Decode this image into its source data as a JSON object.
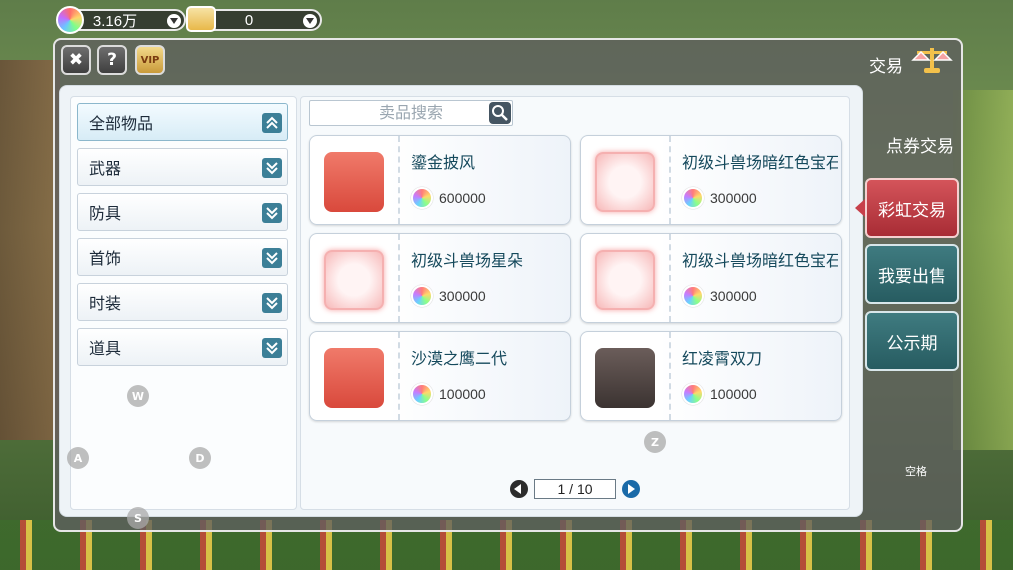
{
  "currency": {
    "rainbow_value": "3.16万",
    "coupon_value": "0"
  },
  "window": {
    "title": "交易",
    "close_label": "✖",
    "help_label": "?",
    "vip_label": "VIP"
  },
  "categories": [
    {
      "label": "全部物品",
      "active": true
    },
    {
      "label": "武器",
      "active": false
    },
    {
      "label": "防具",
      "active": false
    },
    {
      "label": "首饰",
      "active": false
    },
    {
      "label": "时装",
      "active": false
    },
    {
      "label": "道具",
      "active": false
    }
  ],
  "search": {
    "placeholder": "卖品搜索"
  },
  "items": [
    {
      "name": "鎏金披风",
      "price": "600000",
      "thumb": "cape-icon"
    },
    {
      "name": "初级斗兽场暗红色宝石",
      "price": "300000",
      "thumb": "earrings-icon"
    },
    {
      "name": "初级斗兽场星朵",
      "price": "300000",
      "thumb": "pendant-icon"
    },
    {
      "name": "初级斗兽场暗红色宝石",
      "price": "300000",
      "thumb": "ring-icon"
    },
    {
      "name": "沙漠之鹰二代",
      "price": "100000",
      "thumb": "pistol-icon"
    },
    {
      "name": "红凌霄双刀",
      "price": "100000",
      "thumb": "dual-blades-icon"
    }
  ],
  "pager": {
    "text": "1 / 10"
  },
  "side_tabs": {
    "coupon_trade": "点券交易",
    "rainbow_trade": "彩虹交易",
    "sell": "我要出售",
    "public": "公示期"
  },
  "key_hints": {
    "w": "W",
    "a": "A",
    "s": "S",
    "d": "D",
    "z": "Z",
    "space": "空格"
  }
}
